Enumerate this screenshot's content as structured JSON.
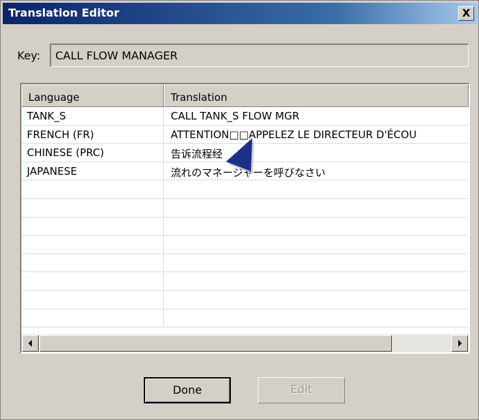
{
  "window": {
    "title": "Translation Editor",
    "close_glyph": "X"
  },
  "key": {
    "label": "Key:",
    "value": "CALL FLOW MANAGER"
  },
  "table": {
    "columns": [
      "Language",
      "Translation"
    ],
    "rows": [
      {
        "language": "TANK_S",
        "translation": "CALL TANK_S FLOW MGR"
      },
      {
        "language": "FRENCH (FR)",
        "translation": "ATTENTION□□APPELEZ LE DIRECTEUR D'ÉCOU"
      },
      {
        "language": "CHINESE (PRC)",
        "translation": "告诉流程经"
      },
      {
        "language": "JAPANESE",
        "translation": "流れのマネージャーを呼びなさい"
      },
      {
        "language": "",
        "translation": ""
      },
      {
        "language": "",
        "translation": ""
      },
      {
        "language": "",
        "translation": ""
      },
      {
        "language": "",
        "translation": ""
      },
      {
        "language": "",
        "translation": ""
      },
      {
        "language": "",
        "translation": ""
      },
      {
        "language": "",
        "translation": ""
      },
      {
        "language": "",
        "translation": ""
      }
    ]
  },
  "buttons": {
    "done": "Done",
    "edit": "Edit"
  },
  "icons": {
    "close": "close-icon",
    "scroll_left": "scroll-left-arrow-icon",
    "scroll_right": "scroll-right-arrow-icon",
    "cursor": "mouse-pointer-icon"
  },
  "colors": {
    "titlebar_start": "#0a246a",
    "titlebar_end": "#a6caf0",
    "dialog_face": "#d4d0c8",
    "cursor": "#1c2f8a"
  }
}
